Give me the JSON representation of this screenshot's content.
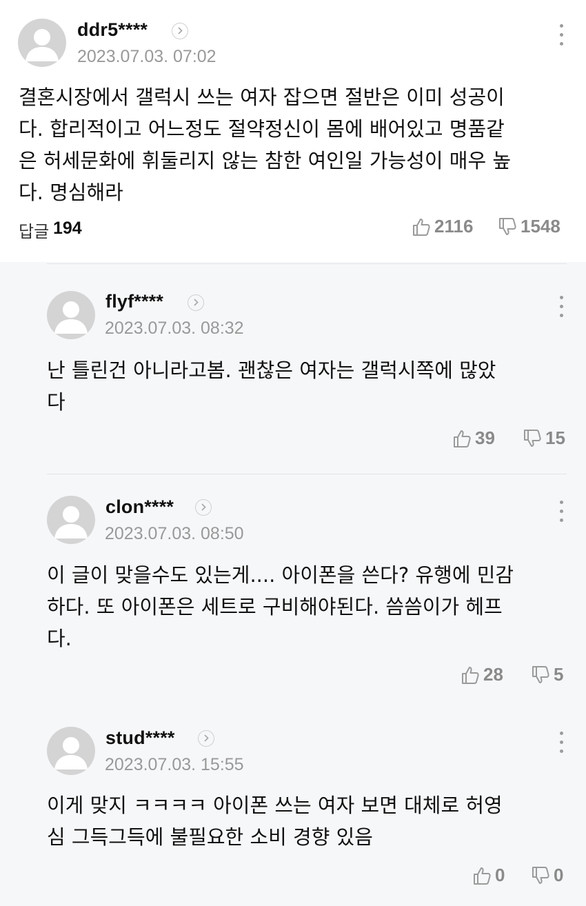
{
  "main_comment": {
    "username": "ddr5****",
    "date": "2023.07.03. 07:02",
    "body": "결혼시장에서 갤럭시 쓰는 여자 잡으면 절반은 이미 성공이\n다. 합리적이고 어느정도 절약정신이 몸에 배어있고 명품같\n은 허세문화에 휘둘리지 않는 참한 여인일 가능성이 매우 높\n다. 명심해라",
    "reply_label": "답글",
    "reply_count": "194",
    "likes": "2116",
    "dislikes": "1548"
  },
  "replies": [
    {
      "username": "flyf****",
      "date": "2023.07.03. 08:32",
      "body": "난 틀린건 아니라고봄. 괜찮은 여자는 갤럭시쪽에 많았\n다",
      "likes": "39",
      "dislikes": "15"
    },
    {
      "username": "clon****",
      "date": "2023.07.03. 08:50",
      "body": "이 글이 맞을수도 있는게.... 아이폰을 쓴다? 유행에 민감\n하다. 또 아이폰은 세트로 구비해야된다. 씀씀이가 헤프\n다.",
      "likes": "28",
      "dislikes": "5"
    },
    {
      "username": "stud****",
      "date": "2023.07.03. 15:55",
      "body": "이게 맞지 ㅋㅋㅋㅋ 아이폰 쓰는 여자 보면 대체로 허영\n심 그득그득에 불필요한 소비 경향 있음",
      "likes": "0",
      "dislikes": "0"
    }
  ],
  "icons": {
    "like": "thumbs-up-icon",
    "dislike": "thumbs-down-icon",
    "profile": "chevron-right-icon",
    "more": "more-vertical-icon",
    "avatar": "default-avatar-icon"
  }
}
